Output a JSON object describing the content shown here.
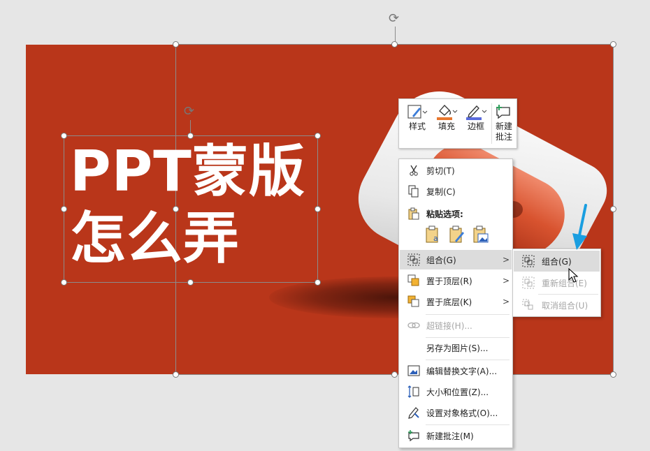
{
  "slide": {
    "background_color": "#b9361a",
    "title_line1": "PPT蒙版",
    "title_line2": "怎么弄"
  },
  "mini_toolbar": {
    "buttons": [
      {
        "label": "样式",
        "icon": "style-brush-icon"
      },
      {
        "label": "填充",
        "icon": "fill-bucket-icon"
      },
      {
        "label": "边框",
        "icon": "outline-pen-icon"
      },
      {
        "label": "新建\n批注",
        "label_line1": "新建",
        "label_line2": "批注",
        "icon": "new-comment-icon"
      }
    ]
  },
  "context_menu": {
    "items": [
      {
        "label": "剪切(T)",
        "icon": "scissors-icon",
        "enabled": true
      },
      {
        "label": "复制(C)",
        "icon": "copy-icon",
        "enabled": true
      },
      {
        "label": "粘贴选项:",
        "icon": "paste-icon",
        "enabled": true
      },
      {
        "label": "组合(G)",
        "icon": "group-icon",
        "enabled": true,
        "submenu": true,
        "highlighted": true
      },
      {
        "label": "置于顶层(R)",
        "icon": "bring-to-front-icon",
        "enabled": true,
        "submenu": true
      },
      {
        "label": "置于底层(K)",
        "icon": "send-to-back-icon",
        "enabled": true,
        "submenu": true
      },
      {
        "label": "超链接(H)...",
        "icon": "link-icon",
        "enabled": false
      },
      {
        "label": "另存为图片(S)...",
        "icon": "",
        "enabled": true
      },
      {
        "label": "编辑替换文字(A)...",
        "icon": "alt-text-icon",
        "enabled": true
      },
      {
        "label": "大小和位置(Z)...",
        "icon": "size-position-icon",
        "enabled": true
      },
      {
        "label": "设置对象格式(O)...",
        "icon": "format-object-icon",
        "enabled": true
      },
      {
        "label": "新建批注(M)",
        "icon": "new-comment-icon",
        "enabled": true
      }
    ],
    "paste_options": [
      "paste-keep-text-icon",
      "paste-format-icon",
      "paste-picture-icon"
    ]
  },
  "group_submenu": {
    "items": [
      {
        "label": "组合(G)",
        "icon": "group-icon",
        "enabled": true,
        "highlighted": true
      },
      {
        "label": "重新组合(E)",
        "icon": "regroup-icon",
        "enabled": false
      },
      {
        "label": "取消组合(U)",
        "icon": "ungroup-icon",
        "enabled": false
      }
    ]
  },
  "colors": {
    "accent_blue": "#1a9ee0",
    "menu_highlight": "#dcdcdc",
    "fill_orange": "#e8772e",
    "outline_blue": "#5a6bdc"
  }
}
